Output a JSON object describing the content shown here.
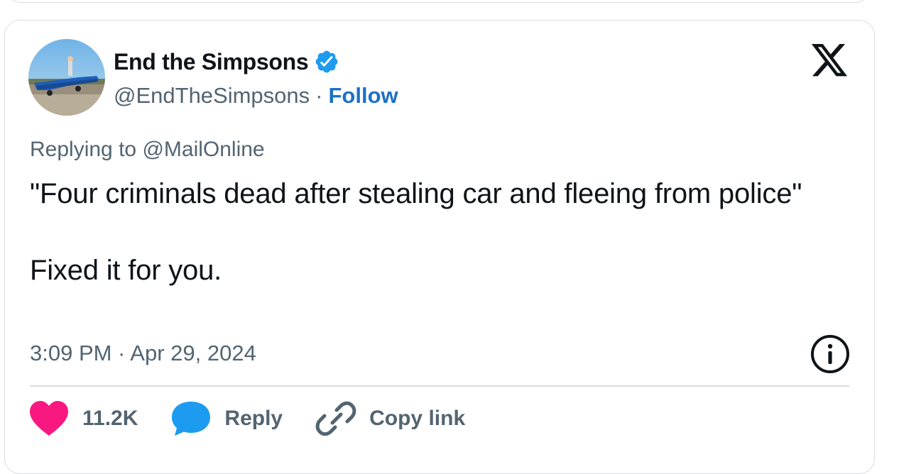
{
  "author": {
    "display_name": "End the Simpsons",
    "handle": "@EndTheSimpsons",
    "separator": "·",
    "follow_label": "Follow",
    "verified": true
  },
  "tweet": {
    "replying_prefix": "Replying to",
    "replying_to": "@MailOnline",
    "text_line_1": "\"Four criminals dead after stealing car and fleeing from police\"",
    "text_line_2": "Fixed it for you.",
    "timestamp": "3:09 PM · Apr 29, 2024"
  },
  "actions": {
    "like_count": "11.2K",
    "reply_label": "Reply",
    "copy_link_label": "Copy link"
  },
  "colors": {
    "accent_blue": "#1d70c8",
    "verified_blue": "#1d9bf0",
    "like_pink": "#f91880",
    "muted_text": "#536471",
    "border": "#d9dde1"
  },
  "icons": [
    "verified-badge-icon",
    "x-logo-icon",
    "info-icon",
    "heart-icon",
    "reply-bubble-icon",
    "link-icon"
  ]
}
